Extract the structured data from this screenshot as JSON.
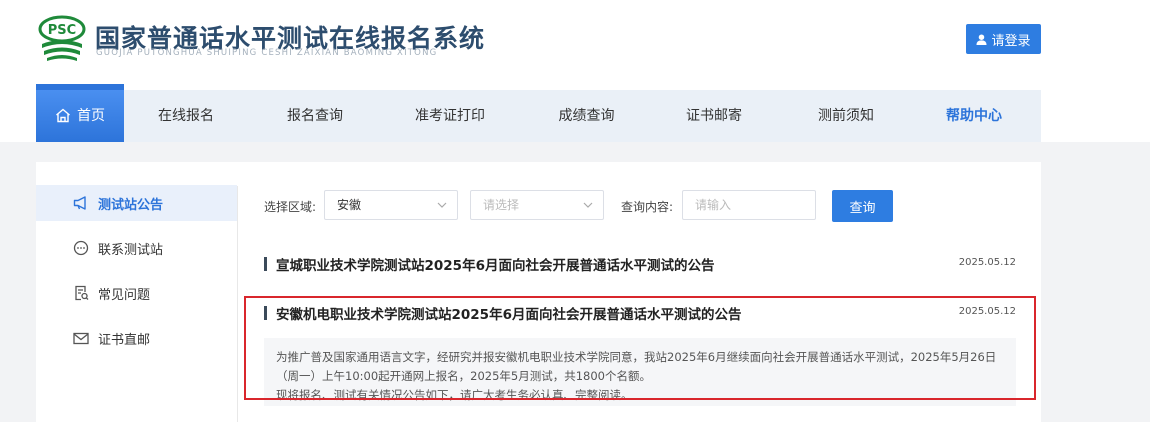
{
  "header": {
    "logo_text": "PSC",
    "title": "国家普通话水平测试在线报名系统",
    "subtitle": "GUOJIA PUTONGHUA SHUIPING CESHI ZAIXIAN BAOMING XITONG",
    "login_label": "请登录"
  },
  "nav": {
    "items": [
      {
        "label": "首页"
      },
      {
        "label": "在线报名"
      },
      {
        "label": "报名查询"
      },
      {
        "label": "准考证打印"
      },
      {
        "label": "成绩查询"
      },
      {
        "label": "证书邮寄"
      },
      {
        "label": "测前须知"
      },
      {
        "label": "帮助中心"
      }
    ],
    "active_index": 0
  },
  "sidebar": {
    "items": [
      {
        "label": "测试站公告",
        "icon": "megaphone-icon"
      },
      {
        "label": "联系测试站",
        "icon": "chat-icon"
      },
      {
        "label": "常见问题",
        "icon": "document-search-icon"
      },
      {
        "label": "证书直邮",
        "icon": "mail-icon"
      }
    ],
    "active_index": 0
  },
  "filters": {
    "region_label": "选择区域:",
    "province_value": "安徽",
    "city_placeholder": "请选择",
    "content_label": "查询内容:",
    "content_placeholder": "请输入",
    "query_label": "查询"
  },
  "notices": [
    {
      "title": "宣城职业技术学院测试站2025年6月面向社会开展普通话水平测试的公告",
      "date": "2025.05.12"
    },
    {
      "title": "安徽机电职业技术学院测试站2025年6月面向社会开展普通话水平测试的公告",
      "date": "2025.05.12",
      "summary": [
        "为推广普及国家通用语言文字，经研究并报安徽机电职业技术学院同意，我站2025年6月继续面向社会开展普通话水平测试，2025年5月26日",
        "（周一）上午10:00起开通网上报名，2025年5月测试，共1800个名额。",
        "现将报名、测试有关情况公告如下，请广大考生务必认真、完整阅读。"
      ]
    }
  ],
  "colors": {
    "primary": "#2e7de1",
    "nav_bg": "#eaf0f7",
    "highlight_border": "#d9262c",
    "title_color": "#2d4d6e"
  }
}
